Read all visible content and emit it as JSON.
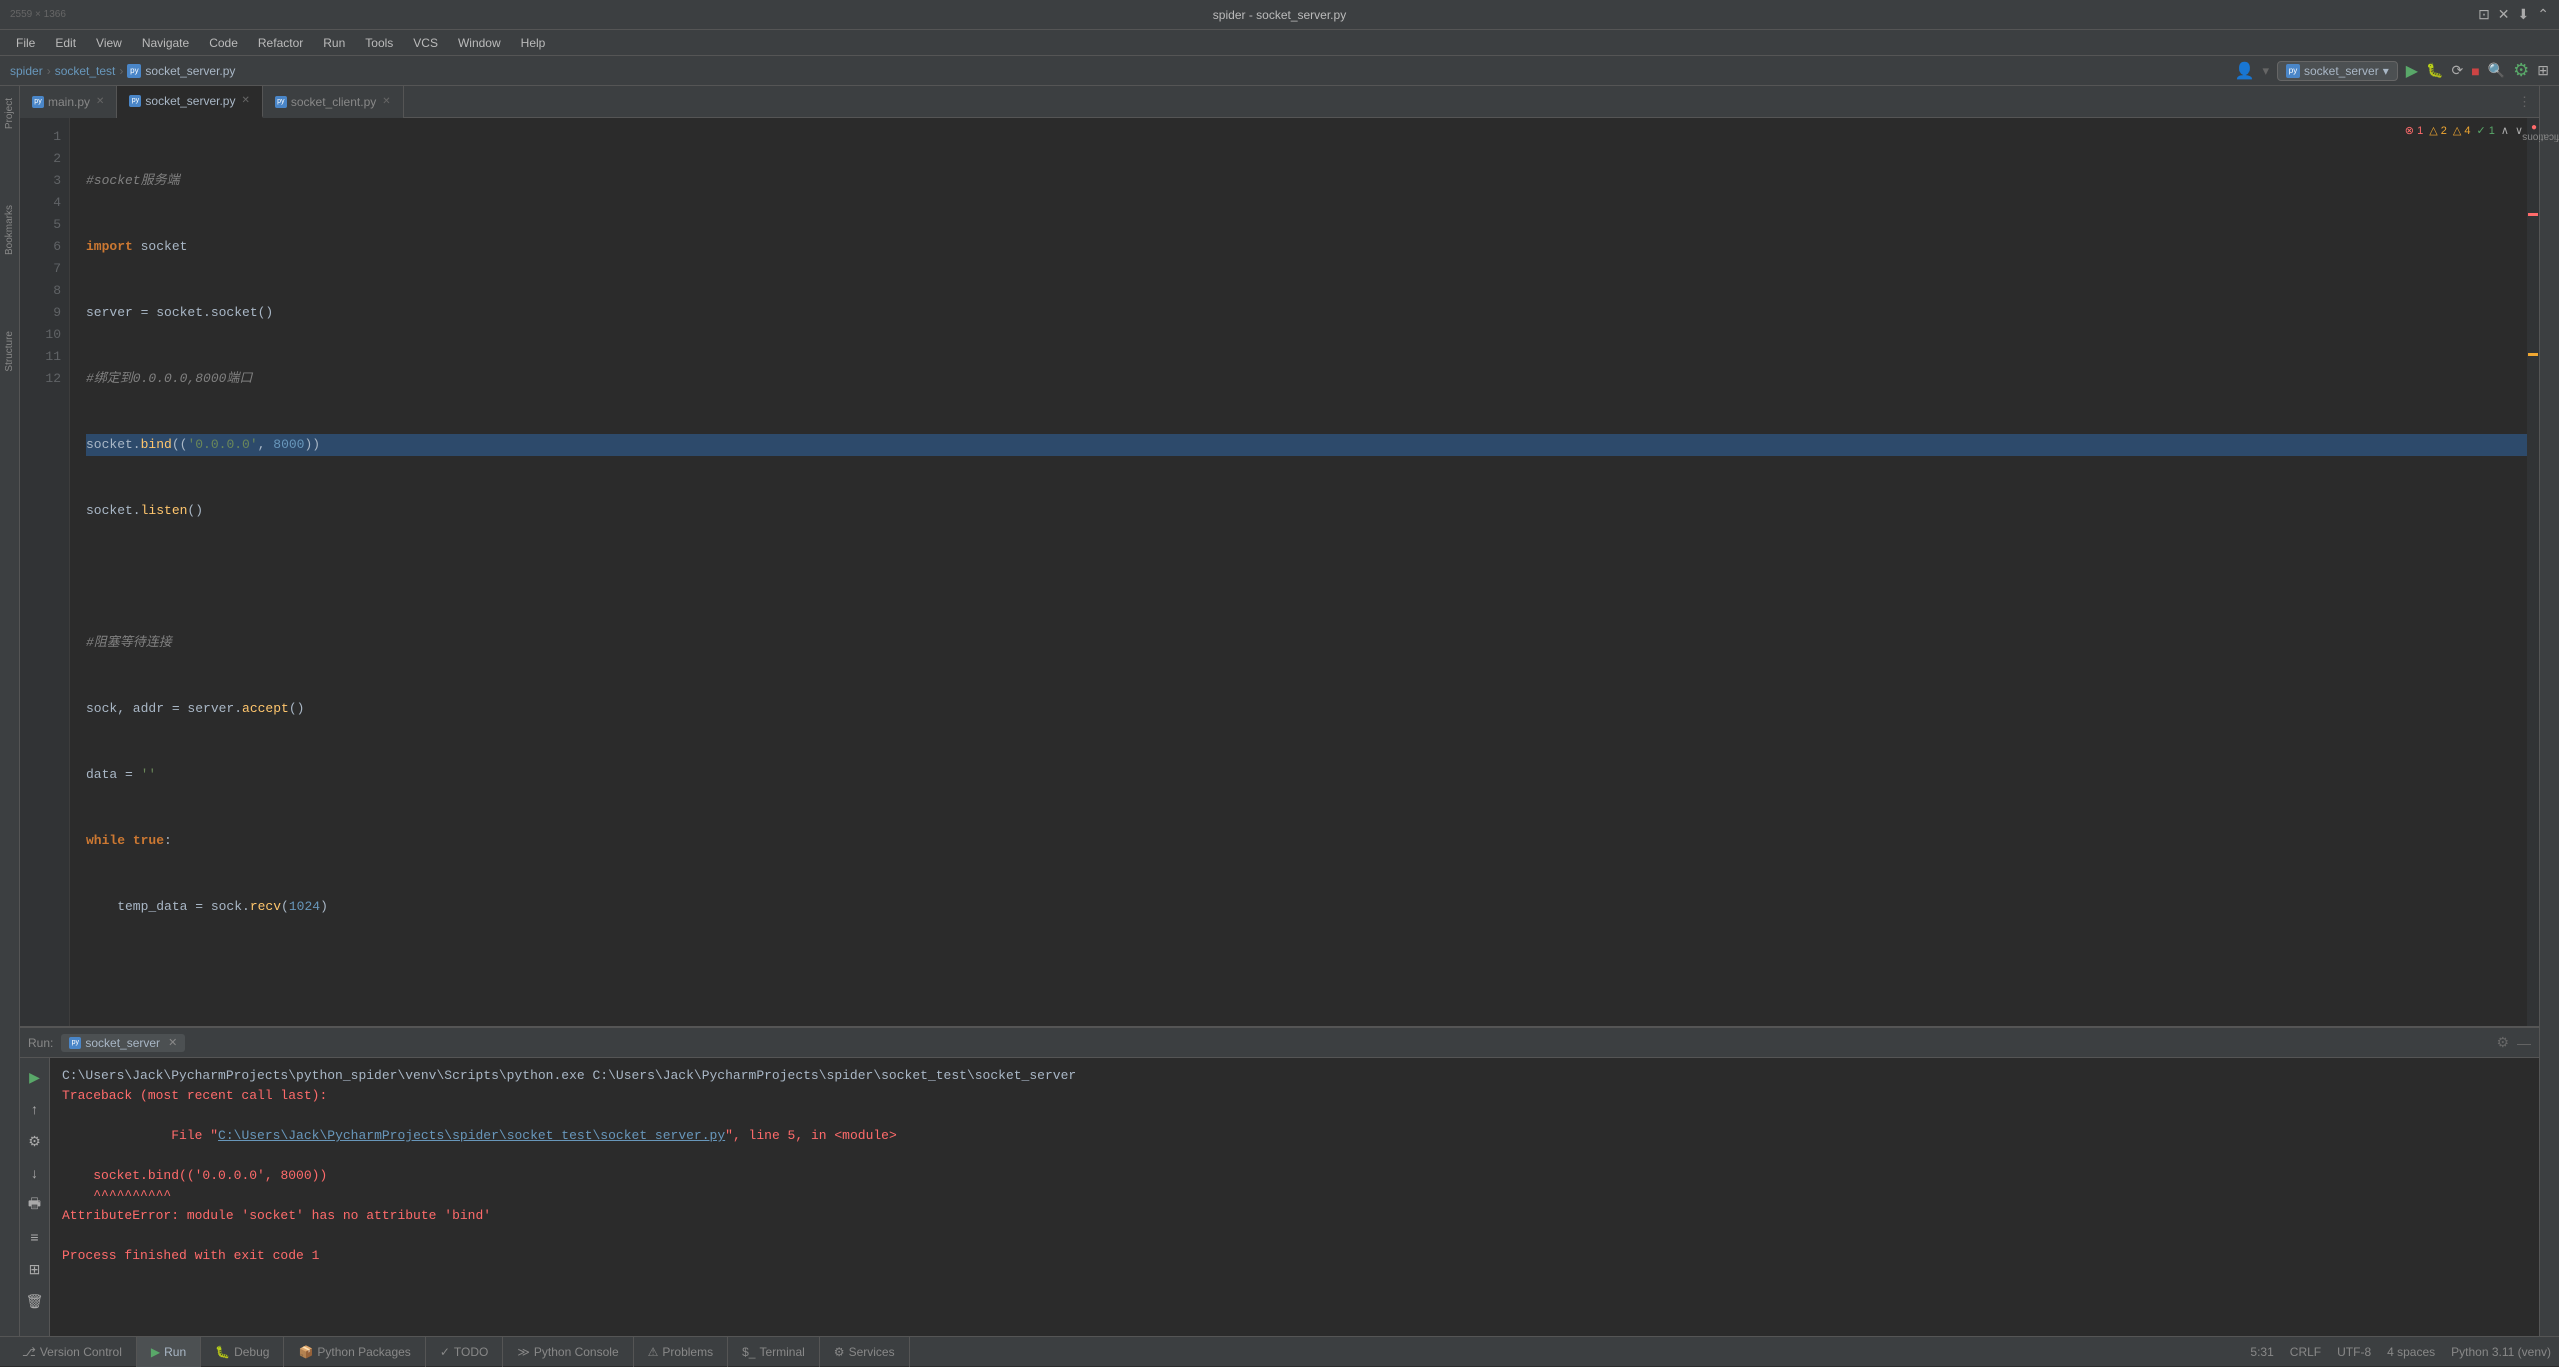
{
  "window": {
    "title": "spider - socket_server.py",
    "dimensions": "2559 × 1366"
  },
  "menu": {
    "items": [
      "File",
      "Edit",
      "View",
      "Navigate",
      "Code",
      "Refactor",
      "Run",
      "Tools",
      "VCS",
      "Window",
      "Help"
    ]
  },
  "breadcrumb": {
    "project": "spider",
    "folder": "socket_test",
    "file": "socket_server.py"
  },
  "run_config": {
    "name": "socket_server",
    "dropdown_arrow": "▾"
  },
  "tabs": [
    {
      "name": "main.py",
      "active": false
    },
    {
      "name": "socket_server.py",
      "active": true
    },
    {
      "name": "socket_client.py",
      "active": false
    }
  ],
  "code": {
    "lines": [
      {
        "num": 1,
        "content": "#socket服务端",
        "type": "comment"
      },
      {
        "num": 2,
        "content": "import socket",
        "type": "import"
      },
      {
        "num": 3,
        "content": "server = socket.socket()",
        "type": "normal"
      },
      {
        "num": 4,
        "content": "#绑定到0.0.0.0,8000端口",
        "type": "comment"
      },
      {
        "num": 5,
        "content": "socket.bind(('0.0.0.0', 8000))",
        "type": "highlighted"
      },
      {
        "num": 6,
        "content": "socket.listen()",
        "type": "normal"
      },
      {
        "num": 7,
        "content": "",
        "type": "empty"
      },
      {
        "num": 8,
        "content": "#阻塞等待连接",
        "type": "comment"
      },
      {
        "num": 9,
        "content": "sock, addr = server.accept()",
        "type": "normal"
      },
      {
        "num": 10,
        "content": "data = ''",
        "type": "normal"
      },
      {
        "num": 11,
        "content": "while true:",
        "type": "while"
      },
      {
        "num": 12,
        "content": "    temp_data = sock.recv(1024)",
        "type": "normal"
      }
    ]
  },
  "run_panel": {
    "label": "Run:",
    "tab": "socket_server",
    "output": {
      "line1": "C:\\Users\\Jack\\PycharmProjects\\python_spider\\venv\\Scripts\\python.exe C:\\Users\\Jack\\PycharmProjects\\spider\\socket_test\\socket_server",
      "line2": "Traceback (most recent call last):",
      "line3_prefix": "  File \"",
      "line3_path": "C:\\Users\\Jack\\PycharmProjects\\spider\\socket_test\\socket_server.py",
      "line3_suffix": "\", line 5, in <module>",
      "line4": "    socket.bind(('0.0.0.0', 8000))",
      "line5": "    ^^^^^^^^^^",
      "line6": "AttributeError: module 'socket' has no attribute 'bind'",
      "line7": "",
      "line8": "Process finished with exit code 1"
    }
  },
  "status_bar": {
    "tabs": [
      {
        "name": "Version Control",
        "icon": "⎇",
        "active": false
      },
      {
        "name": "Run",
        "icon": "▶",
        "active": true
      },
      {
        "name": "Debug",
        "icon": "🐛",
        "active": false
      },
      {
        "name": "Python Packages",
        "icon": "📦",
        "active": false
      },
      {
        "name": "TODO",
        "icon": "✓",
        "active": false
      },
      {
        "name": "Python Console",
        "icon": "≫",
        "active": false
      },
      {
        "name": "Problems",
        "icon": "⚠",
        "active": false
      },
      {
        "name": "Terminal",
        "icon": "$",
        "active": false
      },
      {
        "name": "Services",
        "icon": "⚙",
        "active": false
      }
    ],
    "right": {
      "position": "5:31",
      "crlf": "CRLF",
      "encoding": "UTF-8",
      "indent": "4 spaces",
      "interpreter": "Python 3.11 (venv)"
    }
  },
  "notifications": {
    "errors": "1",
    "warnings": "2",
    "hints": "4",
    "ok": "1"
  }
}
